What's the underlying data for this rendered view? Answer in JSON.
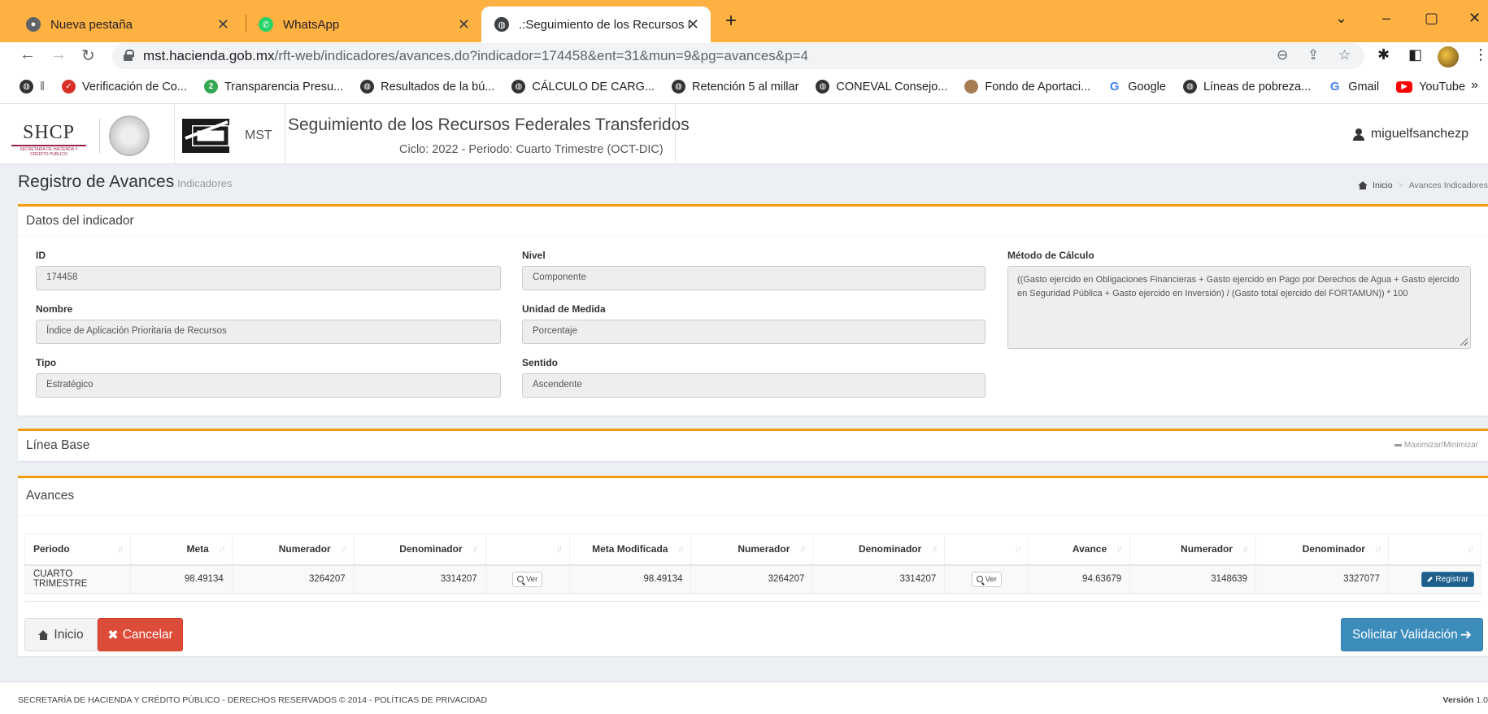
{
  "browser": {
    "tabs": [
      {
        "title": "Nueva pestaña",
        "icon": "chrome-icon"
      },
      {
        "title": "WhatsApp",
        "icon": "whatsapp-icon"
      },
      {
        "title": ".:Seguimiento de los Recursos Fe",
        "icon": "globe-icon"
      }
    ],
    "new_tab": "+",
    "url_host": "mst.hacienda.gob.mx",
    "url_path": "/rft-web/indicadores/avances.do?indicador=174458&ent=31&mun=9&pg=avances&p=4",
    "bookmarks": [
      {
        "label": "Verificación de Co...",
        "icon": "shield-icon",
        "color": "#d93025"
      },
      {
        "label": "Transparencia Presu...",
        "icon": "circle-icon",
        "color": "#34a853"
      },
      {
        "label": "Resultados de la bú...",
        "icon": "globe-icon",
        "color": "#333333"
      },
      {
        "label": "CÁLCULO DE CARG...",
        "icon": "globe-icon",
        "color": "#333333"
      },
      {
        "label": "Retención 5 al millar",
        "icon": "globe-icon",
        "color": "#333333"
      },
      {
        "label": "CONEVAL Consejo...",
        "icon": "globe-icon",
        "color": "#333333"
      },
      {
        "label": "Fondo de Aportaci...",
        "icon": "circle-icon",
        "color": "#a67c52"
      },
      {
        "label": "Google",
        "icon": "google-icon",
        "color": "#4285f4"
      },
      {
        "label": "Líneas de pobreza...",
        "icon": "globe-icon",
        "color": "#333333"
      },
      {
        "label": "Gmail",
        "icon": "google-icon",
        "color": "#4285f4"
      },
      {
        "label": "YouTube",
        "icon": "youtube-icon",
        "color": "#ff0000"
      }
    ]
  },
  "header": {
    "shcp": "SHCP",
    "shcp_sub": "SECRETARÍA DE HACIENDA Y CRÉDITO PÚBLICO",
    "mst": "MST",
    "title": "Seguimiento de los Recursos Federales Transferidos",
    "subtitle": "Ciclo: 2022 - Periodo: Cuarto Trimestre (OCT-DIC)",
    "user": "miguelfsanchezp"
  },
  "content": {
    "title": "Registro de Avances",
    "title_small": "Indicadores",
    "breadcrumb": [
      "Inicio",
      "Avances Indicadores"
    ]
  },
  "indicador": {
    "box_title": "Datos del indicador",
    "fields": {
      "id": {
        "label": "ID",
        "value": "174458"
      },
      "nivel": {
        "label": "Nivel",
        "value": "Componente"
      },
      "nombre": {
        "label": "Nombre",
        "value": "Índice de Aplicación Prioritaria de Recursos"
      },
      "unidad": {
        "label": "Unidad de Medida",
        "value": "Porcentaje"
      },
      "tipo": {
        "label": "Tipo",
        "value": "Estratégico"
      },
      "sentido": {
        "label": "Sentido",
        "value": "Ascendente"
      },
      "metodo": {
        "label": "Método de Cálculo",
        "value": "((Gasto ejercido en Obligaciones Financieras + Gasto ejercido en Pago por Derechos de Agua + Gasto ejercido en Seguridad Pública + Gasto ejercido en Inversión) / (Gasto total ejercido del FORTAMUN)) * 100"
      }
    }
  },
  "linea_base": {
    "box_title": "Línea Base",
    "toggle": "Maximizar/Minimizar"
  },
  "avances": {
    "box_title": "Avances",
    "columns": [
      "Periodo",
      "Meta",
      "Numerador",
      "Denominador",
      "",
      "Meta Modificada",
      "Numerador",
      "Denominador",
      "",
      "Avance",
      "Numerador",
      "Denominador",
      ""
    ],
    "row": {
      "periodo": "CUARTO TRIMESTRE",
      "meta": "98.49134",
      "numerador": "3264207",
      "denominador": "3314207",
      "ver1": "Ver",
      "meta_mod": "98.49134",
      "numerador_mod": "3264207",
      "denominador_mod": "3314207",
      "ver2": "Ver",
      "avance": "94.63679",
      "numerador_av": "3148639",
      "denominador_av": "3327077",
      "registrar": "Registrar"
    },
    "buttons": {
      "inicio": "Inicio",
      "cancelar": "Cancelar",
      "solicitar": "Solicitar Validación"
    }
  },
  "footer": {
    "text": "SECRETARÍA DE HACIENDA Y CRÉDITO PÚBLICO - DERECHOS RESERVADOS © 2014 - POLÍTICAS DE PRIVACIDAD",
    "version_label": "Versión",
    "version_value": "1.0"
  }
}
